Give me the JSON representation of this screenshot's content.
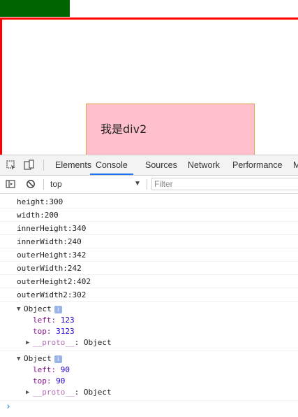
{
  "page": {
    "div2_text": "我是div2",
    "colors": {
      "green": "#006400",
      "red": "#ff0000",
      "pink": "#ffc0cb"
    }
  },
  "devtools": {
    "tabs": [
      {
        "label": "Elements",
        "active": false
      },
      {
        "label": "Console",
        "active": true
      },
      {
        "label": "Sources",
        "active": false
      },
      {
        "label": "Network",
        "active": false
      },
      {
        "label": "Performance",
        "active": false
      },
      {
        "label": "M",
        "active": false
      }
    ],
    "toolbar_icons": [
      "inspect-element-icon",
      "device-toolbar-icon"
    ],
    "console_bar": {
      "context": "top",
      "filter_placeholder": "Filter",
      "icons": [
        "sidebar-toggle-icon",
        "clear-console-icon",
        "dropdown-arrow-icon"
      ]
    },
    "logs": [
      "height:300",
      "width:200",
      "innerHeight:340",
      "innerWidth:240",
      "outerHeight:342",
      "outerWidth:242",
      "outerHeight2:402",
      "outerWidth2:302"
    ],
    "objects": [
      {
        "label": "Object",
        "props": [
          {
            "key": "left",
            "value": "123"
          },
          {
            "key": "top",
            "value": "3123"
          }
        ],
        "proto_key": "__proto__",
        "proto_value": ": Object"
      },
      {
        "label": "Object",
        "props": [
          {
            "key": "left",
            "value": "90"
          },
          {
            "key": "top",
            "value": "90"
          }
        ],
        "proto_key": "__proto__",
        "proto_value": ": Object"
      }
    ],
    "prompt_symbol": "›",
    "info_badge": "i"
  }
}
